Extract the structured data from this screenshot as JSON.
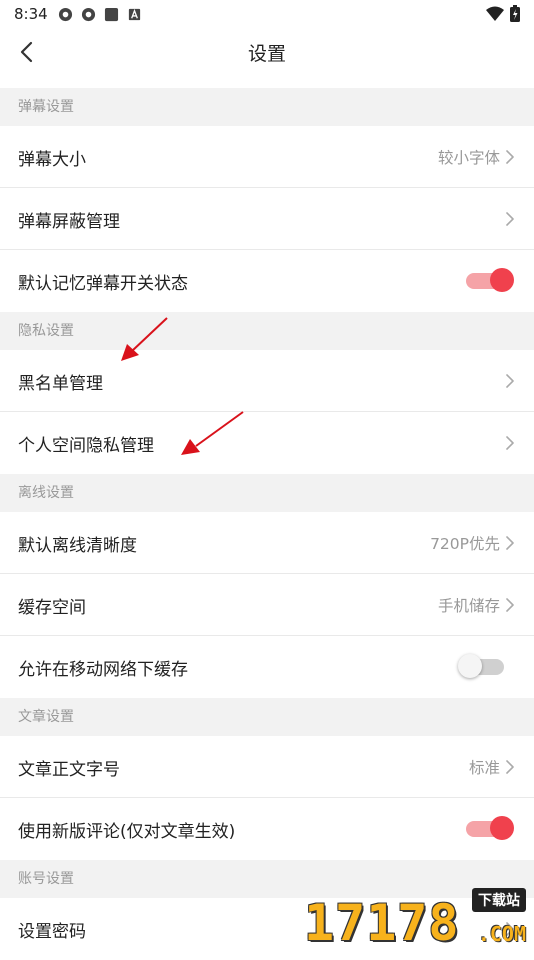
{
  "status_bar": {
    "time": "8:34",
    "icons": [
      "app-icon",
      "app-icon",
      "stop-icon",
      "a-icon"
    ],
    "right_icons": [
      "wifi-icon",
      "battery-icon"
    ]
  },
  "header": {
    "title": "设置",
    "back_icon": "back-arrow-icon"
  },
  "colors": {
    "accent": "#f0414d",
    "accent_track": "#f5a3a7",
    "background": "#f2f2f2",
    "secondary_text": "#999999"
  },
  "sections": [
    {
      "label": "弹幕设置",
      "rows": [
        {
          "label": "弹幕大小",
          "value": "较小字体",
          "type": "chevron"
        },
        {
          "label": "弹幕屏蔽管理",
          "value": "",
          "type": "chevron"
        },
        {
          "label": "默认记忆弹幕开关状态",
          "type": "toggle",
          "on": true
        }
      ]
    },
    {
      "label": "隐私设置",
      "rows": [
        {
          "label": "黑名单管理",
          "value": "",
          "type": "chevron"
        },
        {
          "label": "个人空间隐私管理",
          "value": "",
          "type": "chevron"
        }
      ]
    },
    {
      "label": "离线设置",
      "rows": [
        {
          "label": "默认离线清晰度",
          "value": "720P优先",
          "type": "chevron"
        },
        {
          "label": "缓存空间",
          "value": "手机储存",
          "type": "chevron"
        },
        {
          "label": "允许在移动网络下缓存",
          "type": "toggle",
          "on": false
        }
      ]
    },
    {
      "label": "文章设置",
      "rows": [
        {
          "label": "文章正文字号",
          "value": "标准",
          "type": "chevron"
        },
        {
          "label": "使用新版评论(仅对文章生效)",
          "type": "toggle",
          "on": true
        }
      ]
    },
    {
      "label": "账号设置",
      "rows": [
        {
          "label": "设置密码",
          "value": "",
          "type": "chevron"
        }
      ]
    }
  ],
  "watermark": {
    "digits": "17178",
    "badge": "下载站",
    "suffix": ".COM"
  }
}
